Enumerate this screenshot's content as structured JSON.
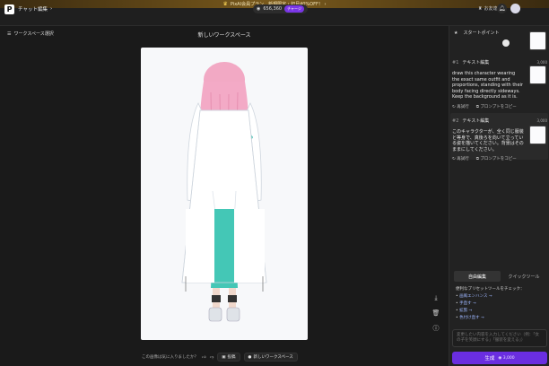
{
  "banner": {
    "text": "PixAI会員プラン　新規限定・初月40%OFF！ ›"
  },
  "header": {
    "breadcrumb": "チャット編集",
    "credits": "656,360",
    "credits_badge": "チャージ",
    "invite": "お友達紹介"
  },
  "workspace": {
    "select_label": "ワークスペース選択",
    "title": "新しいワークスペース"
  },
  "feedback": {
    "question": "この画像は気に入りましたか？",
    "post_label": "投稿",
    "new_ws_label": "新しいワークスペース"
  },
  "panel": {
    "start_label": "スタートポイント",
    "history": [
      {
        "num": "#1",
        "type": "テキスト編集",
        "cost": "3,000",
        "prompt": "draw this character wearing the exact same outfit and proportions, standing with their body facing directly sideways. Keep the background as it is.",
        "retry": "再試行",
        "copy": "プロンプトをコピー"
      },
      {
        "num": "#2",
        "type": "テキスト編集",
        "cost": "3,000",
        "prompt": "このキャラクターが、全く同じ服装と等身で、真後ろを向いて立っている姿を描いてください。背景はそのままにしてください。",
        "retry": "再試行",
        "copy": "プロンプトをコピー"
      }
    ],
    "tabs": [
      "自由編集",
      "クイックツール"
    ],
    "tips_heading": "便利なプリセットツールをチェック：",
    "tips": [
      "画風エンハンス →",
      "手直す →",
      "拡張 →",
      "色付け直す →"
    ],
    "input_placeholder": "変更したい内容を入力してください（例：「女の子を笑顔にする」「服装を変える」）",
    "generate_label": "生成",
    "generate_cost": "3,000"
  },
  "colors": {
    "accent": "#6a2ee0",
    "banner": "#7a5a1c",
    "link": "#9db6ff"
  }
}
